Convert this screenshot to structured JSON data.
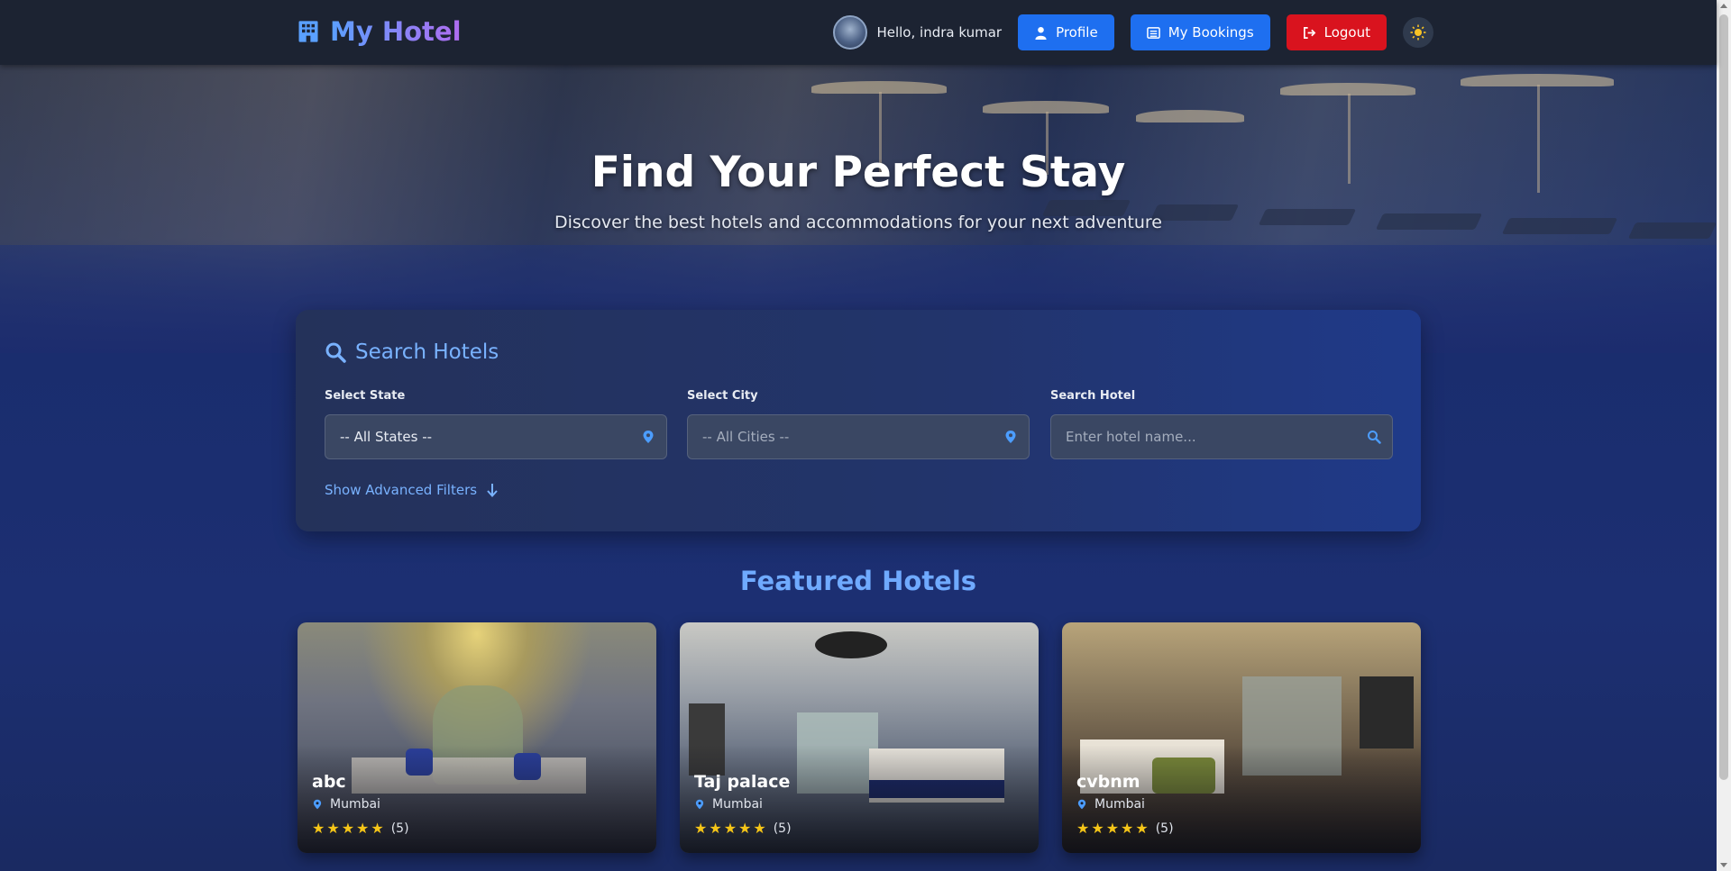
{
  "brand": {
    "title": "My Hotel",
    "icon": "hotel-building-icon"
  },
  "nav": {
    "greeting": "Hello, indra kumar",
    "profile_label": "Profile",
    "bookings_label": "My Bookings",
    "logout_label": "Logout",
    "theme_icon": "sun-icon"
  },
  "hero": {
    "title": "Find Your Perfect Stay",
    "subtitle": "Discover the best hotels and accommodations for your next adventure"
  },
  "search": {
    "title": "Search Hotels",
    "state_label": "Select State",
    "state_value": "-- All States --",
    "city_label": "Select City",
    "city_value": "-- All Cities --",
    "hotel_label": "Search Hotel",
    "hotel_placeholder": "Enter hotel name...",
    "advanced_label": "Show Advanced Filters"
  },
  "featured": {
    "title": "Featured Hotels",
    "hotels": [
      {
        "name": "abc",
        "location": "Mumbai",
        "rating": 5,
        "rating_text": "(5)"
      },
      {
        "name": "Taj palace",
        "location": "Mumbai",
        "rating": 5,
        "rating_text": "(5)"
      },
      {
        "name": "cvbnm",
        "location": "Mumbai",
        "rating": 5,
        "rating_text": "(5)"
      }
    ]
  },
  "colors": {
    "accent_blue": "#1e6ff0",
    "logout_red": "#d9131e",
    "star_gold": "#f5c518",
    "heading_blue": "#6faaff"
  }
}
